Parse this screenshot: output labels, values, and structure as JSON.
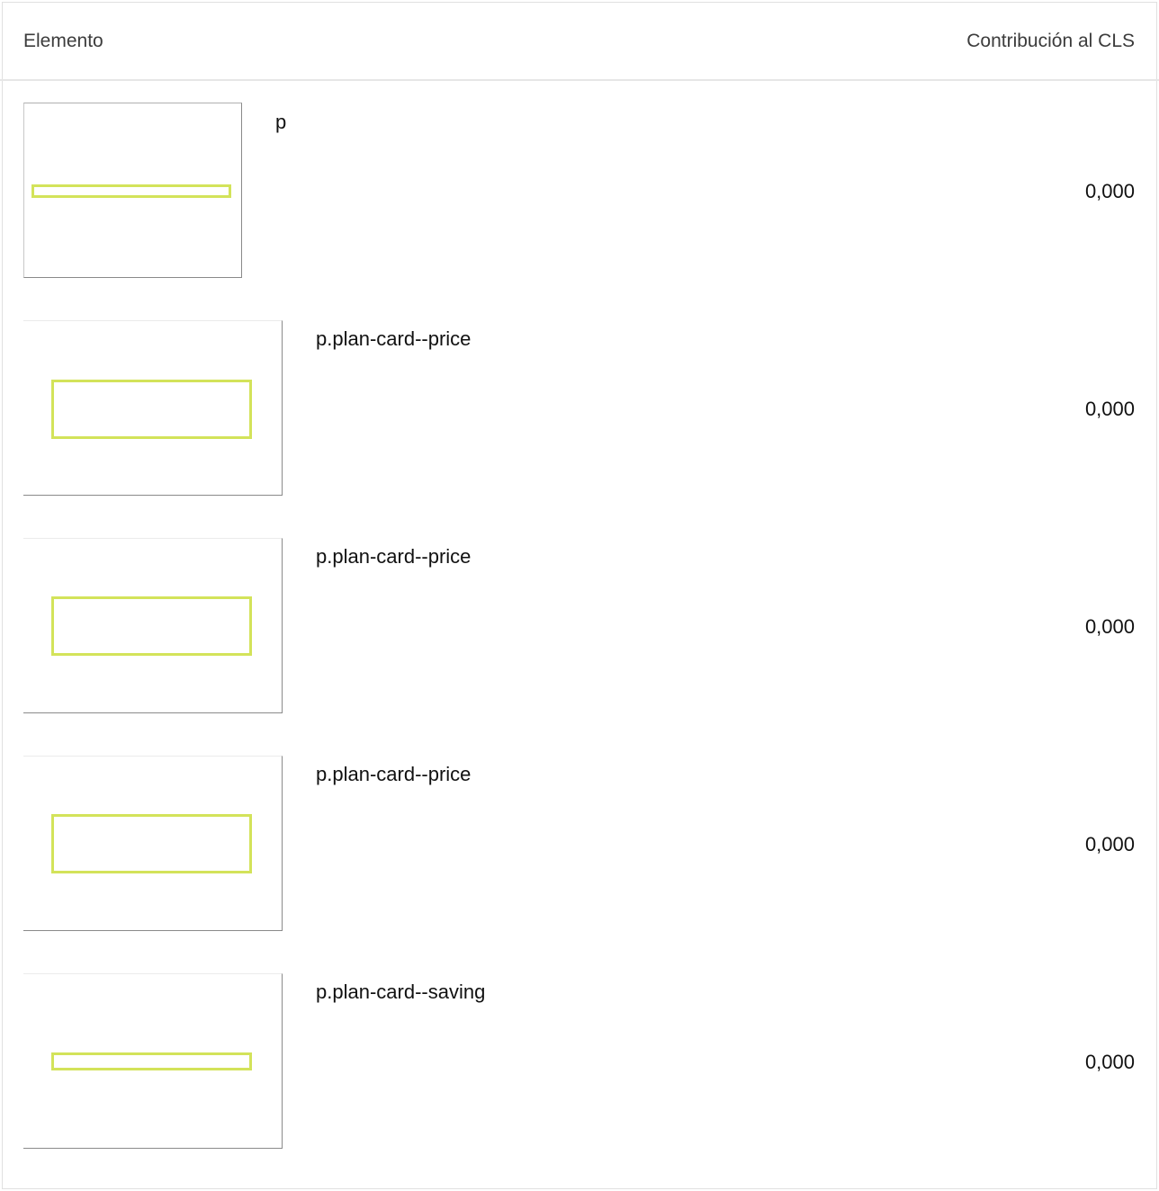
{
  "table": {
    "headers": {
      "element": "Elemento",
      "cls_contribution": "Contribución al CLS"
    },
    "rows": [
      {
        "selector": "p",
        "value": "0,000"
      },
      {
        "selector": "p.plan-card--price",
        "value": "0,000"
      },
      {
        "selector": "p.plan-card--price",
        "value": "0,000"
      },
      {
        "selector": "p.plan-card--price",
        "value": "0,000"
      },
      {
        "selector": "p.plan-card--saving",
        "value": "0,000"
      }
    ]
  },
  "colors": {
    "highlight": "#d3e35a",
    "text": "#111111",
    "header_text": "#3c3c3c"
  }
}
